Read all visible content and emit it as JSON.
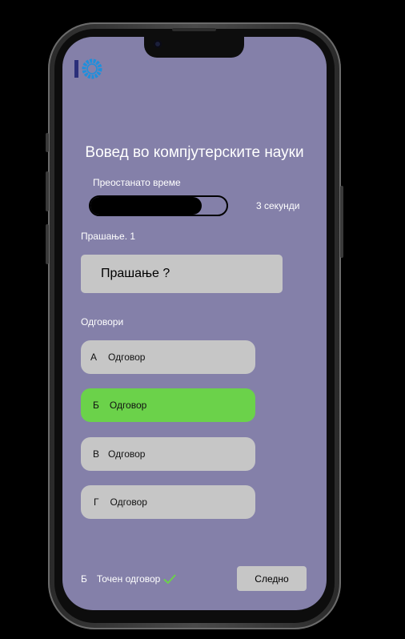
{
  "quiz": {
    "title": "Вовед во компјутерските науки",
    "timer": {
      "label": "Преостанато време",
      "remaining_text": "3 секунди",
      "progress_fraction": 0.82
    },
    "question": {
      "number_label": "Прашање. 1",
      "text": "Прашање ?"
    },
    "answers_label": "Одговори",
    "answers": [
      {
        "letter": "А",
        "text": "Одговор",
        "correct": false
      },
      {
        "letter": "Б",
        "text": "Одговор",
        "correct": true
      },
      {
        "letter": "В",
        "text": "Одговор",
        "correct": false
      },
      {
        "letter": "Г",
        "text": "Одговор",
        "correct": false
      }
    ],
    "footer": {
      "correct_letter": "Б",
      "correct_label": "Точен одговор",
      "check_icon": "check-icon",
      "next_label": "Следно"
    }
  },
  "colors": {
    "screen_bg": "#8480a9",
    "card_bg": "#c6c6c6",
    "correct_green": "#6bd24a",
    "logo_blue": "#1f8fdc",
    "logo_dark": "#2b2f7a"
  }
}
